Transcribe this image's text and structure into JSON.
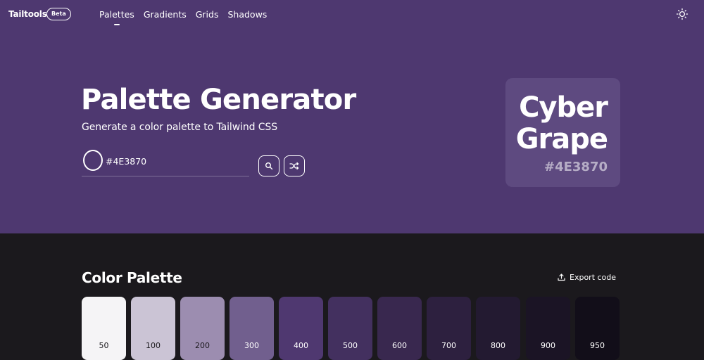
{
  "nav": {
    "brand": "Tailtools",
    "badge": "Beta",
    "links": [
      "Palettes",
      "Gradients",
      "Grids",
      "Shadows"
    ],
    "theme_icon": "sun-icon"
  },
  "hero": {
    "title": "Palette Generator",
    "subtitle": "Generate a color palette to Tailwind CSS",
    "input_value": "#4E3870",
    "search_icon": "search-icon",
    "shuffle_icon": "shuffle-icon"
  },
  "name_card": {
    "line1": "Cyber",
    "line2": "Grape",
    "hex": "#4E3870"
  },
  "palette": {
    "title": "Color Palette",
    "export_label": "Export code",
    "export_icon": "upload-icon",
    "swatches": [
      {
        "label": "50",
        "color": "#f5f4f6",
        "text": "#1b191d"
      },
      {
        "label": "100",
        "color": "#cbc4d5",
        "text": "#1b191d"
      },
      {
        "label": "200",
        "color": "#9c8db0",
        "text": "#1b191d"
      },
      {
        "label": "300",
        "color": "#715f8e",
        "text": "#ffffff"
      },
      {
        "label": "400",
        "color": "#4f3870",
        "text": "#ffffff"
      },
      {
        "label": "500",
        "color": "#43305f",
        "text": "#ffffff"
      },
      {
        "label": "600",
        "color": "#39284f",
        "text": "#ffffff"
      },
      {
        "label": "700",
        "color": "#2d203f",
        "text": "#ffffff"
      },
      {
        "label": "800",
        "color": "#231a31",
        "text": "#ffffff"
      },
      {
        "label": "900",
        "color": "#1b1425",
        "text": "#ffffff"
      },
      {
        "label": "950",
        "color": "#120e19",
        "text": "#ffffff"
      }
    ]
  },
  "colors": {
    "hero_bg": "#4e3870",
    "page_bg": "#1b191d",
    "card_bg": "#5e4a80"
  }
}
